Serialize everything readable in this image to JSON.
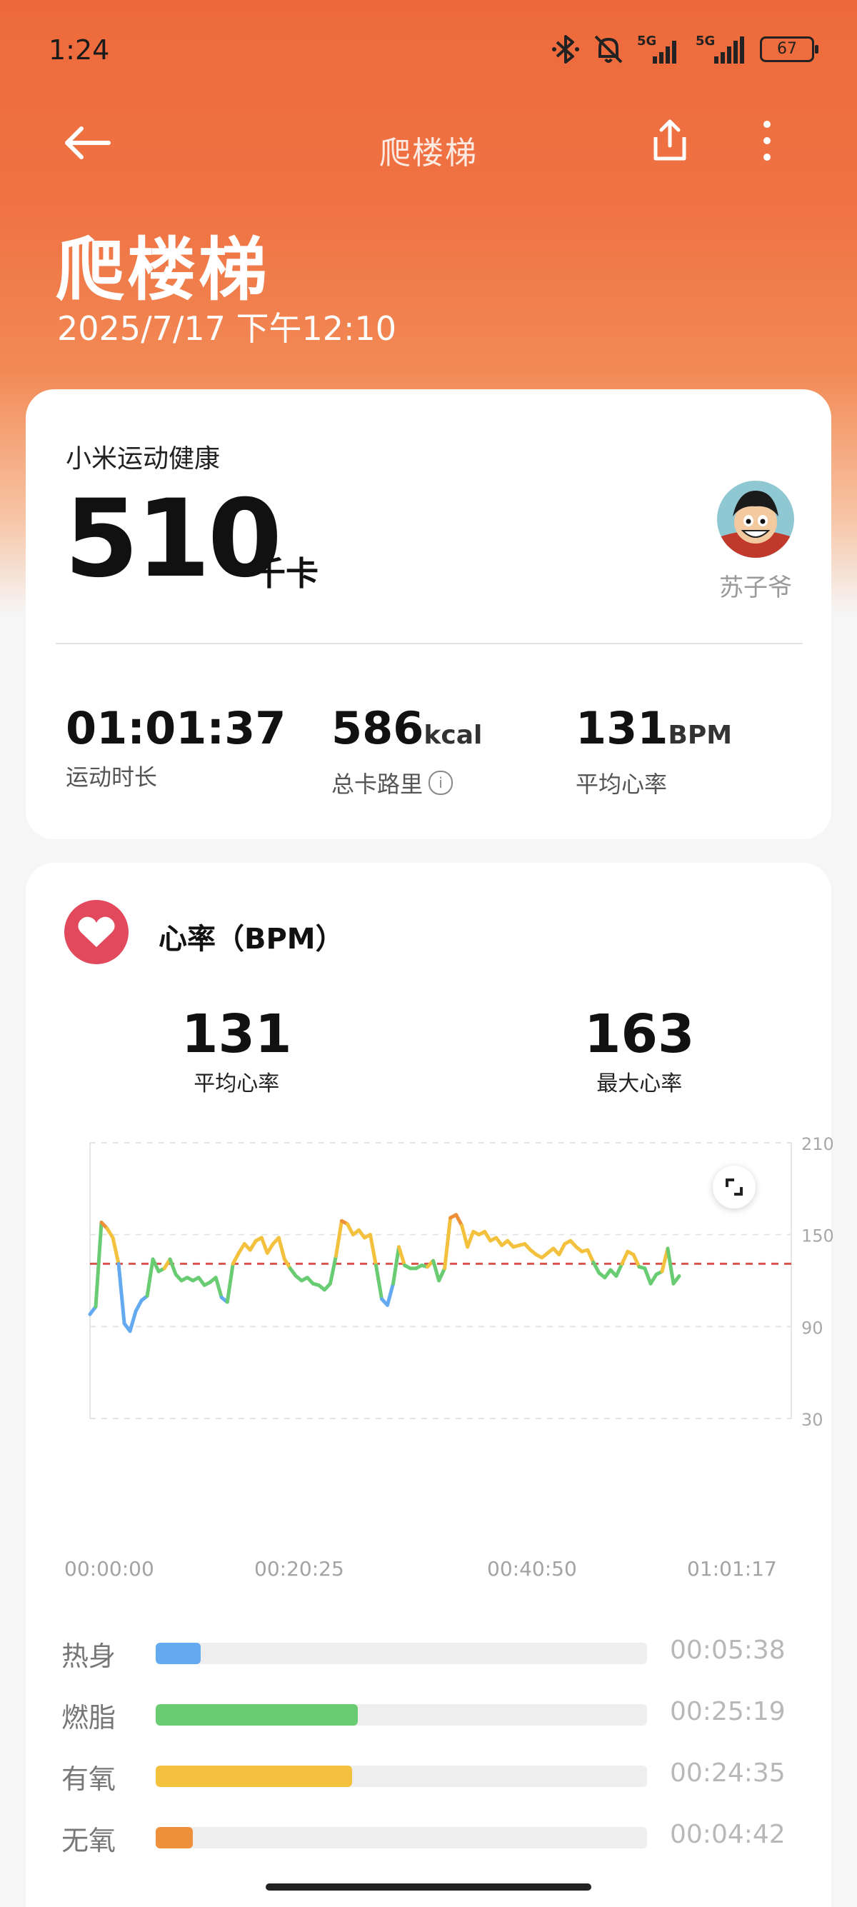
{
  "status_bar": {
    "time": "1:24",
    "battery": "67",
    "icons": [
      "bluetooth-icon",
      "mute-bell-icon",
      "signal-5g-icon",
      "signal-5g-icon",
      "battery-icon"
    ],
    "sim1_label": "5G",
    "sim2_label": "5G"
  },
  "app_bar": {
    "title": "爬楼梯",
    "back_icon": "back-arrow-icon",
    "share_icon": "share-icon",
    "more_icon": "more-vertical-icon"
  },
  "hero": {
    "title": "爬楼梯",
    "date": "2025/7/17 下午12:10"
  },
  "summary": {
    "source": "小米运动健康",
    "calories": "510",
    "calories_unit": "千卡",
    "username": "苏子爷",
    "stats": [
      {
        "value": "01:01:37",
        "unit": "",
        "label": "运动时长"
      },
      {
        "value": "586",
        "unit": "kcal",
        "label": "总卡路里"
      },
      {
        "value": "131",
        "unit": "BPM",
        "label": "平均心率"
      }
    ]
  },
  "heart_rate": {
    "title": "心率（BPM）",
    "avg_value": "131",
    "avg_label": "平均心率",
    "max_value": "163",
    "max_label": "最大心率"
  },
  "chart_data": {
    "type": "line",
    "x_tick_labels": [
      "00:00:00",
      "00:20:25",
      "00:40:50",
      "01:01:17"
    ],
    "y_tick_labels": [
      "210",
      "150",
      "90",
      "30"
    ],
    "ylim": [
      30,
      210
    ],
    "xlim_minutes": [
      0,
      61.3
    ],
    "average_line": 131,
    "series": [
      {
        "x_minutes": [
          0,
          0.5,
          1,
          1.5,
          2,
          2.5,
          3,
          3.5,
          4,
          4.5,
          5,
          5.5,
          6,
          6.5,
          7,
          7.5,
          8,
          8.5,
          9,
          9.5,
          10,
          10.5,
          11,
          11.5,
          12,
          12.5,
          13,
          13.5,
          14,
          14.5,
          15,
          15.5,
          16,
          16.5,
          17,
          17.5,
          18,
          18.5,
          19,
          19.5,
          20,
          20.5,
          21,
          21.5,
          22,
          22.5,
          23,
          23.5,
          24,
          24.5,
          25,
          25.5,
          26,
          26.5,
          27,
          27.5,
          28,
          28.5,
          29,
          29.5,
          30,
          30.5,
          31,
          31.5,
          32,
          32.5,
          33,
          33.5,
          34,
          34.5,
          35,
          35.5,
          36,
          36.5,
          37,
          37.5,
          38,
          38.5,
          39,
          39.5,
          40,
          40.5,
          41,
          41.5,
          42,
          42.5,
          43,
          43.5,
          44,
          44.5,
          45,
          45.5,
          46,
          46.5,
          47,
          47.5,
          48,
          48.5,
          49,
          49.5,
          50,
          50.5,
          51,
          51.5,
          52,
          52.5,
          53,
          53.5,
          54,
          54.5,
          55,
          55.5,
          56,
          56.5,
          57,
          57.5,
          58,
          58.5,
          59,
          59.5,
          60,
          60.5,
          61,
          61.3
        ],
        "values": [
          98,
          103,
          158,
          154,
          148,
          131,
          92,
          87,
          100,
          107,
          110,
          134,
          126,
          128,
          134,
          124,
          120,
          122,
          120,
          122,
          117,
          119,
          122,
          109,
          106,
          131,
          138,
          144,
          140,
          146,
          148,
          138,
          144,
          148,
          134,
          128,
          123,
          120,
          122,
          118,
          117,
          114,
          118,
          136,
          159,
          157,
          150,
          153,
          148,
          150,
          130,
          108,
          104,
          118,
          142,
          130,
          128,
          128,
          130,
          129,
          133,
          120,
          128,
          161,
          163,
          156,
          142,
          152,
          150,
          152,
          146,
          148,
          143,
          146,
          142,
          143,
          144,
          140,
          137,
          135,
          138,
          141,
          137,
          144,
          146,
          142,
          139,
          140,
          132,
          125,
          122,
          127,
          123,
          131,
          139,
          137,
          129,
          128,
          118,
          124,
          126,
          141,
          118,
          123
        ],
        "zones_note": "line colored by heart-rate zone: blue warm-up, green fat-burn, yellow aerobic, orange anaerobic"
      }
    ],
    "grid": "dashed horizontal",
    "legend": "none"
  },
  "zones": [
    {
      "name": "热身",
      "time": "00:05:38",
      "fraction": 0.092,
      "color": "#64aaf0"
    },
    {
      "name": "燃脂",
      "time": "00:25:19",
      "fraction": 0.411,
      "color": "#69cc72"
    },
    {
      "name": "有氧",
      "time": "00:24:35",
      "fraction": 0.399,
      "color": "#f3c13e"
    },
    {
      "name": "无氧",
      "time": "00:04:42",
      "fraction": 0.076,
      "color": "#ee8f3a"
    }
  ],
  "colors": {
    "brand_orange": "#ee6a3b",
    "heart_red": "#e2495d",
    "avg_line": "#d9534f"
  }
}
